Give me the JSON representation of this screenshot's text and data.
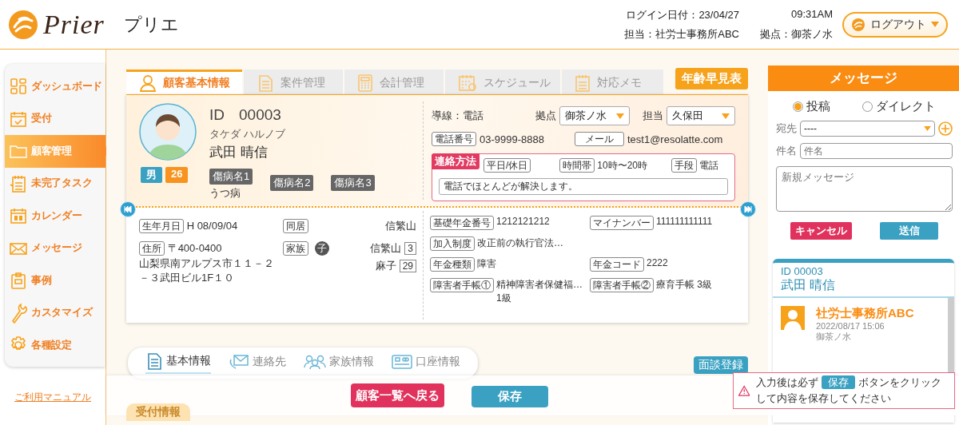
{
  "header": {
    "logo_text": "Prier",
    "app_name": "プリエ",
    "login_date": "ログイン日付：23/04/27",
    "login_time": "09:31AM",
    "staff": "担当：社労士事務所ABC",
    "base": "拠点：御茶ノ水",
    "logout": "ログアウト"
  },
  "sidebar": {
    "items": [
      {
        "label": "ダッシュボード",
        "selected": false
      },
      {
        "label": "受付",
        "selected": false
      },
      {
        "label": "顧客管理",
        "selected": true
      },
      {
        "label": "未完了タスク",
        "selected": false
      },
      {
        "label": "カレンダー",
        "selected": false
      },
      {
        "label": "メッセージ",
        "selected": false
      },
      {
        "label": "事例",
        "selected": false
      },
      {
        "label": "カスタマイズ",
        "selected": false
      },
      {
        "label": "各種設定",
        "selected": false
      }
    ],
    "manual_link": "ご利用マニュアル"
  },
  "tabs": [
    {
      "label": "顧客基本情報",
      "selected": true
    },
    {
      "label": "案件管理",
      "selected": false
    },
    {
      "label": "会計管理",
      "selected": false
    },
    {
      "label": "スケジュール",
      "selected": false
    },
    {
      "label": "対応メモ",
      "selected": false
    }
  ],
  "age_table_button": "年齢早見表",
  "profile": {
    "id_label": "ID",
    "id": "00003",
    "kana": "タケダ ハルノブ",
    "name": "武田 晴信",
    "gender": "男",
    "age": "26",
    "diseases": [
      {
        "label": "傷病名1",
        "value": "うつ病"
      },
      {
        "label": "傷病名2"
      },
      {
        "label": "傷病名3"
      }
    ]
  },
  "contact": {
    "route": "導線：電話",
    "base_label": "拠点",
    "base_value": "御茶ノ水",
    "staff_label": "担当",
    "staff_value": "久保田",
    "phone_label": "電話番号",
    "phone": "03-9999-8888",
    "mail_label": "メール",
    "mail": "test1@resolatte.com",
    "method": {
      "title": "連絡方法",
      "days_label": "平日/休日",
      "time_label": "時間帯",
      "time": "10時〜20時",
      "means_label": "手段",
      "means": "電話",
      "note": "電話でほとんどが解決します。"
    }
  },
  "details": {
    "birth_label": "生年月日",
    "birth": "H 08/09/04",
    "address_label": "住所",
    "zip": "〒400-0400",
    "address": "山梨県南アルプス市１１－２－３武田ビル1F１０",
    "cohabit_label": "同居",
    "cohabit": "信繁山",
    "family_label": "家族",
    "family_badge": "子",
    "family": [
      {
        "name": "信繁山",
        "age": "3"
      },
      {
        "name": "麻子",
        "age": "29"
      }
    ]
  },
  "pension": [
    {
      "label": "基礎年金番号",
      "value": "1212121212"
    },
    {
      "label": "マイナンバー",
      "value": "111111111111"
    },
    {
      "label": "加入制度",
      "value": "改正前の執行官法…"
    },
    {
      "label": "年金種類",
      "value": "障害"
    },
    {
      "label": "年金コード",
      "value": "2222"
    },
    {
      "label": "障害者手帳①",
      "value": "精神障害者保健福…\n1級"
    },
    {
      "label": "障害者手帳②",
      "value": "療育手帳 3級"
    }
  ],
  "subtabs": [
    {
      "label": "基本情報",
      "selected": true
    },
    {
      "label": "連絡先",
      "selected": false
    },
    {
      "label": "家族情報",
      "selected": false
    },
    {
      "label": "口座情報",
      "selected": false
    }
  ],
  "interview_button": "面談登録",
  "section_title": "受付情報",
  "footer": {
    "back": "顧客一覧へ戻る",
    "save": "保存"
  },
  "toast": {
    "text": "入力後は必ず **保存** ボタンをクリックして内容を保存してください"
  },
  "messages": {
    "title": "メッセージ",
    "post_types": [
      {
        "label": "投稿",
        "selected": true
      },
      {
        "label": "ダイレクト",
        "selected": false
      }
    ],
    "to_label": "宛先",
    "to_value": "----",
    "subject_label": "件名",
    "subject_placeholder": "件名",
    "body_placeholder": "新規メッセージ",
    "cancel": "キャンセル",
    "send": "送信",
    "thread": {
      "id": "ID 00003",
      "name": "武田 晴信",
      "posts": [
        {
          "author": "社労士事務所ABC",
          "date": "2022/08/17 15:06",
          "base": "御茶ノ水"
        }
      ]
    }
  }
}
